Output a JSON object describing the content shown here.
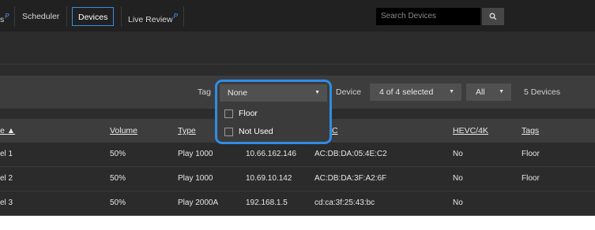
{
  "nav": {
    "partial_label": "s",
    "partial_sup": "P",
    "scheduler": "Scheduler",
    "devices": "Devices",
    "live_review": "Live Review",
    "live_review_sup": "P",
    "search_placeholder": "Search Devices"
  },
  "filters": {
    "tag_label": "Tag",
    "tag_value": "None",
    "tag_options": [
      "Floor",
      "Not Used"
    ],
    "device_label": "Device",
    "device_value": "4 of 4 selected",
    "all_value": "All",
    "device_count": "5 Devices"
  },
  "table": {
    "headers": {
      "name": "e ▲",
      "volume": "Volume",
      "type": "Type",
      "mac": "C",
      "hevc": "HEVC/4K",
      "tags": "Tags"
    },
    "rows": [
      {
        "name": "el 1",
        "volume": "50%",
        "type": "Play 1000",
        "ip": "10.66.162.146",
        "mac": "AC:DB:DA:05:4E:C2",
        "hevc": "No",
        "tags": "Floor"
      },
      {
        "name": "el 2",
        "volume": "50%",
        "type": "Play 1000",
        "ip": "10.69.10.142",
        "mac": "AC:DB:DA:3F:A2:6F",
        "hevc": "No",
        "tags": "Floor"
      },
      {
        "name": "el 3",
        "volume": "50%",
        "type": "Play 2000A",
        "ip": "192.168.1.5",
        "mac": "cd:ca:3f:25:43:bc",
        "hevc": "No",
        "tags": ""
      }
    ]
  }
}
